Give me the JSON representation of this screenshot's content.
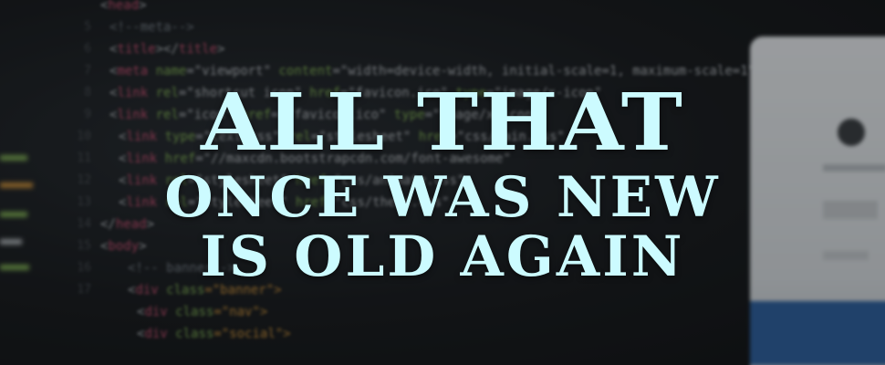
{
  "headline": {
    "line1": "ALL THAT",
    "line2": "ONCE WAS NEW",
    "line3": "IS OLD AGAIN",
    "color": "#ccfbff"
  },
  "code_background": {
    "line_numbers": [
      "5",
      "6",
      "7",
      "8",
      "9",
      "10",
      "11",
      "12",
      "13",
      "14",
      "15",
      "16",
      "17"
    ],
    "lines": [
      [
        {
          "t": "<",
          "c": "w"
        },
        {
          "t": "head",
          "c": "k"
        },
        {
          "t": ">",
          "c": "w"
        }
      ],
      [
        {
          "t": "<!--meta-->",
          "c": "c"
        }
      ],
      [
        {
          "t": "<",
          "c": "w"
        },
        {
          "t": "title",
          "c": "k"
        },
        {
          "t": "></",
          "c": "w"
        },
        {
          "t": "title",
          "c": "k"
        },
        {
          "t": ">",
          "c": "w"
        }
      ],
      [
        {
          "t": "<",
          "c": "w"
        },
        {
          "t": "meta ",
          "c": "k"
        },
        {
          "t": "name",
          "c": "g"
        },
        {
          "t": "=\"viewport\" ",
          "c": "w"
        },
        {
          "t": "content",
          "c": "g"
        },
        {
          "t": "=\"width=device-width, initial-scale=1, maximum-scale=1\"",
          "c": "w"
        }
      ],
      [
        {
          "t": "<",
          "c": "w"
        },
        {
          "t": "link ",
          "c": "k"
        },
        {
          "t": "rel",
          "c": "g"
        },
        {
          "t": "=\"shortcut icon\" ",
          "c": "w"
        },
        {
          "t": "href",
          "c": "g"
        },
        {
          "t": "=\"favicon.ico\" ",
          "c": "w"
        },
        {
          "t": "type",
          "c": "g"
        },
        {
          "t": "=\"image/x-icon\"",
          "c": "w"
        }
      ],
      [
        {
          "t": "<",
          "c": "w"
        },
        {
          "t": "link ",
          "c": "k"
        },
        {
          "t": "rel",
          "c": "g"
        },
        {
          "t": "=\"icon\" ",
          "c": "w"
        },
        {
          "t": "href",
          "c": "g"
        },
        {
          "t": "=\"/favicon.ico\" ",
          "c": "w"
        },
        {
          "t": "type",
          "c": "g"
        },
        {
          "t": "=\"image/x-icon\"",
          "c": "w"
        }
      ],
      [
        {
          "t": "<",
          "c": "w"
        },
        {
          "t": "link ",
          "c": "k"
        },
        {
          "t": "type",
          "c": "g"
        },
        {
          "t": "=\"text/css\" ",
          "c": "w"
        },
        {
          "t": "rel",
          "c": "g"
        },
        {
          "t": "=\"stylesheet\" ",
          "c": "w"
        },
        {
          "t": "href",
          "c": "g"
        },
        {
          "t": "=\"css/main.css\"",
          "c": "w"
        }
      ],
      [
        {
          "t": "<",
          "c": "w"
        },
        {
          "t": "link ",
          "c": "k"
        },
        {
          "t": "href",
          "c": "g"
        },
        {
          "t": "=\"//maxcdn.bootstrapcdn.com/font-awesome\"",
          "c": "w"
        }
      ],
      [
        {
          "t": "<",
          "c": "w"
        },
        {
          "t": "link ",
          "c": "k"
        },
        {
          "t": "rel",
          "c": "g"
        },
        {
          "t": "=\"stylesheet\" ",
          "c": "w"
        },
        {
          "t": "href",
          "c": "g"
        },
        {
          "t": "=\"css/animate.css\"",
          "c": "w"
        }
      ],
      [
        {
          "t": "<",
          "c": "w"
        },
        {
          "t": "link ",
          "c": "k"
        },
        {
          "t": "rel",
          "c": "g"
        },
        {
          "t": "=\"stylesheet\" ",
          "c": "w"
        },
        {
          "t": "href",
          "c": "g"
        },
        {
          "t": "=\"css/theme.css\"",
          "c": "w"
        }
      ],
      [
        {
          "t": "</",
          "c": "w"
        },
        {
          "t": "head",
          "c": "k"
        },
        {
          "t": ">",
          "c": "w"
        }
      ],
      [
        {
          "t": "<",
          "c": "w"
        },
        {
          "t": "body",
          "c": "k"
        },
        {
          "t": ">",
          "c": "w"
        }
      ],
      [
        {
          "t": "<!-- banner-->",
          "c": "c"
        }
      ],
      [
        {
          "t": "<",
          "c": "w"
        },
        {
          "t": "div ",
          "c": "k"
        },
        {
          "t": "class",
          "c": "g"
        },
        {
          "t": "=\"banner\">",
          "c": "o"
        }
      ],
      [
        {
          "t": "<",
          "c": "w"
        },
        {
          "t": "div ",
          "c": "k"
        },
        {
          "t": "class",
          "c": "g"
        },
        {
          "t": "=\"nav\">",
          "c": "o"
        }
      ],
      [
        {
          "t": "<",
          "c": "w"
        },
        {
          "t": "div ",
          "c": "k"
        },
        {
          "t": "class",
          "c": "g"
        },
        {
          "t": "=\"social\">",
          "c": "o"
        }
      ]
    ]
  }
}
